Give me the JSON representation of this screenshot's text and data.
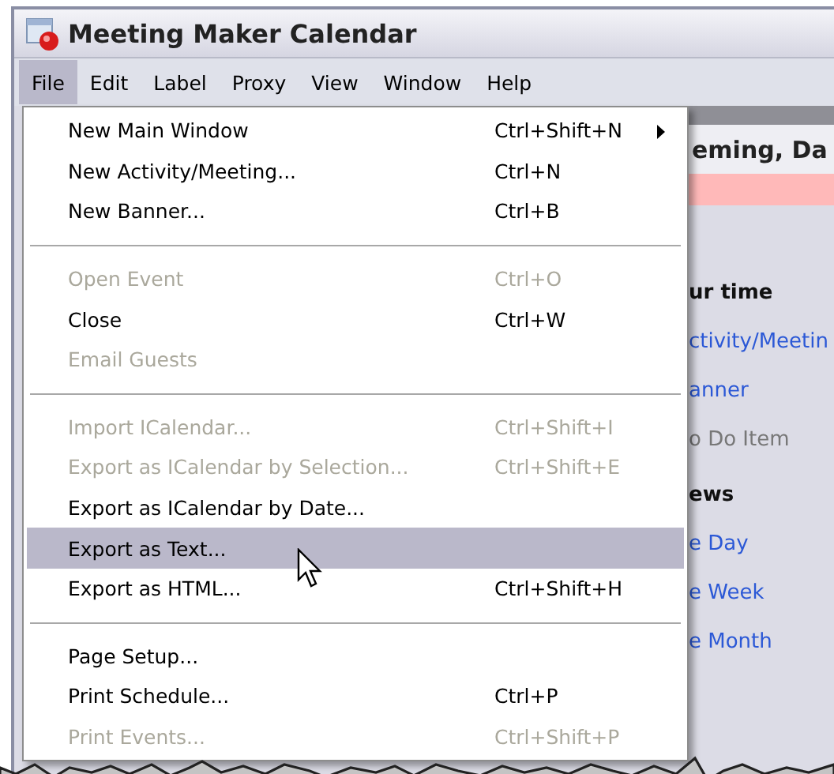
{
  "window": {
    "title": "Meeting Maker Calendar"
  },
  "menubar": [
    {
      "label": "File",
      "selected": true
    },
    {
      "label": "Edit",
      "selected": false
    },
    {
      "label": "Label",
      "selected": false
    },
    {
      "label": "Proxy",
      "selected": false
    },
    {
      "label": "View",
      "selected": false
    },
    {
      "label": "Window",
      "selected": false
    },
    {
      "label": "Help",
      "selected": false
    }
  ],
  "file_menu": [
    [
      {
        "label": "New Main Window",
        "shortcut": "Ctrl+Shift+N",
        "disabled": false,
        "selected": false,
        "submenu": true
      },
      {
        "label": "New Activity/Meeting...",
        "shortcut": "Ctrl+N",
        "disabled": false,
        "selected": false,
        "submenu": false
      },
      {
        "label": "New Banner...",
        "shortcut": "Ctrl+B",
        "disabled": false,
        "selected": false,
        "submenu": false
      }
    ],
    [
      {
        "label": "Open Event",
        "shortcut": "Ctrl+O",
        "disabled": true,
        "selected": false,
        "submenu": false
      },
      {
        "label": "Close",
        "shortcut": "Ctrl+W",
        "disabled": false,
        "selected": false,
        "submenu": false
      },
      {
        "label": "Email Guests",
        "disabled": true,
        "selected": false,
        "submenu": false
      }
    ],
    [
      {
        "label": "Import ICalendar...",
        "shortcut": "Ctrl+Shift+I",
        "disabled": true,
        "selected": false,
        "submenu": false
      },
      {
        "label": "Export as ICalendar by Selection...",
        "shortcut": "Ctrl+Shift+E",
        "disabled": true,
        "selected": false,
        "submenu": false
      },
      {
        "label": "Export as ICalendar by Date...",
        "disabled": false,
        "selected": false,
        "submenu": false
      },
      {
        "label": "Export as Text...",
        "disabled": false,
        "selected": true,
        "submenu": false
      },
      {
        "label": "Export as HTML...",
        "shortcut": "Ctrl+Shift+H",
        "disabled": false,
        "selected": false,
        "submenu": false
      }
    ],
    [
      {
        "label": "Page Setup...",
        "disabled": false,
        "selected": false,
        "submenu": false
      },
      {
        "label": "Print Schedule...",
        "shortcut": "Ctrl+P",
        "disabled": false,
        "selected": false,
        "submenu": false
      },
      {
        "label": "Print Events...",
        "shortcut": "Ctrl+Shift+P",
        "disabled": true,
        "selected": false,
        "submenu": false
      }
    ]
  ],
  "panel": {
    "title": "eming, Da",
    "items": [
      {
        "kind": "heading",
        "label": "ur time"
      },
      {
        "kind": "link",
        "label": "ctivity/Meetin"
      },
      {
        "kind": "link",
        "label": "anner"
      },
      {
        "kind": "muted",
        "label": "o Do Item"
      },
      {
        "kind": "heading",
        "label": "ews"
      },
      {
        "kind": "link",
        "label": "e Day"
      },
      {
        "kind": "link",
        "label": "e Week"
      },
      {
        "kind": "link",
        "label": "e Month"
      }
    ]
  }
}
